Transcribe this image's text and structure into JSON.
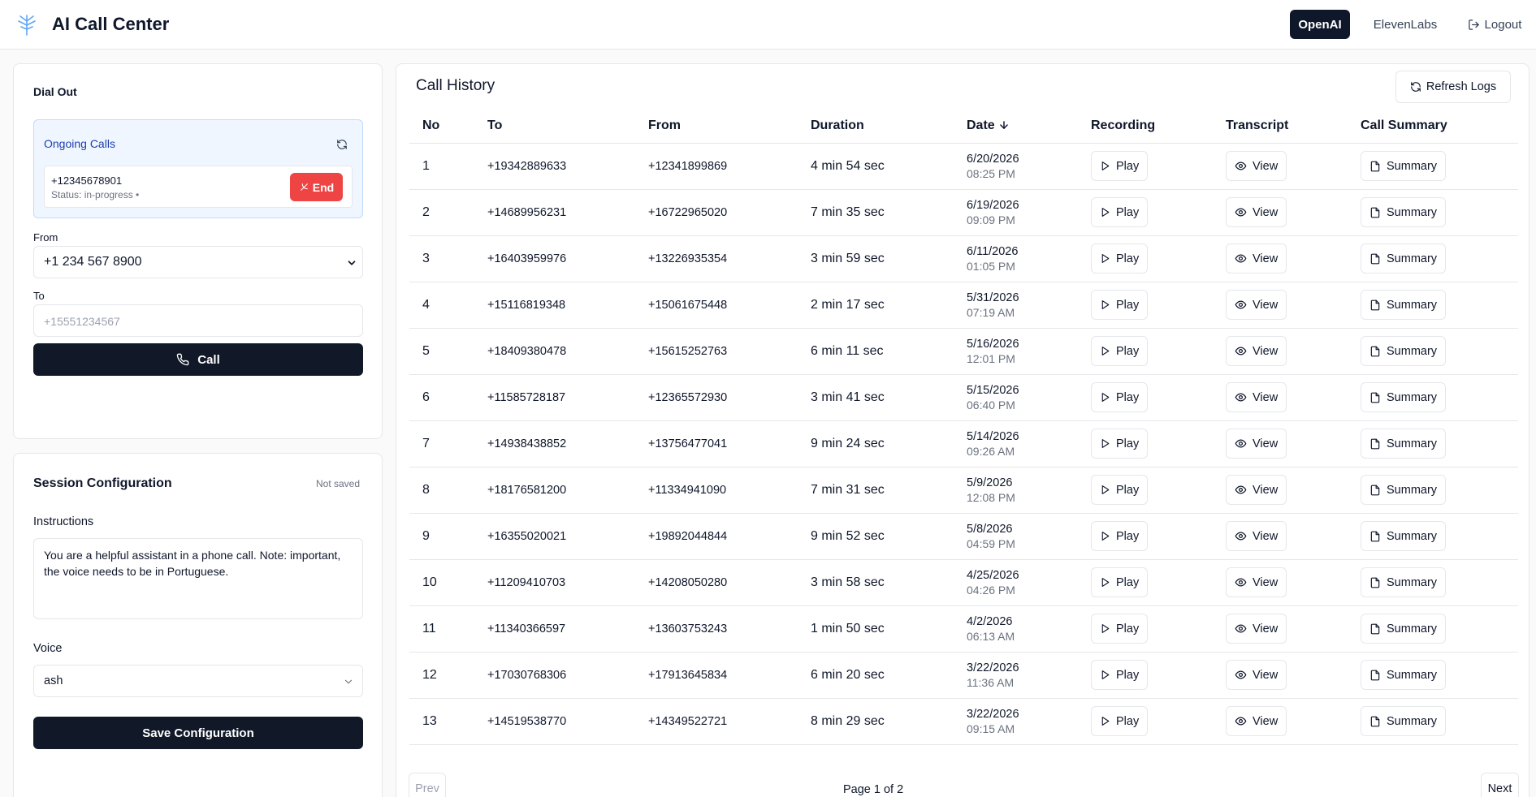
{
  "header": {
    "title": "AI Call Center",
    "providers": [
      "OpenAI",
      "ElevenLabs"
    ],
    "active_provider": "OpenAI",
    "logout_label": "Logout"
  },
  "dial_out": {
    "title": "Dial Out",
    "ongoing": {
      "title": "Ongoing Calls",
      "calls": [
        {
          "number": "+12345678901",
          "status": "Status: in-progress •",
          "end_label": "End"
        }
      ]
    },
    "from_label": "From",
    "from_value": "+1 234 567 8900",
    "to_label": "To",
    "to_placeholder": "+15551234567",
    "call_label": "Call"
  },
  "session": {
    "title": "Session Configuration",
    "status": "Not saved",
    "instructions_label": "Instructions",
    "instructions_value": "You are a helpful assistant in a phone call. Note: important, the voice needs to be in Portuguese.",
    "voice_label": "Voice",
    "voice_value": "ash",
    "save_label": "Save Configuration"
  },
  "history": {
    "title": "Call History",
    "refresh_label": "Refresh Logs",
    "columns": [
      "No",
      "To",
      "From",
      "Duration",
      "Date",
      "Recording",
      "Transcript",
      "Call Summary"
    ],
    "play_label": "Play",
    "view_label": "View",
    "summary_label": "Summary",
    "rows": [
      {
        "no": "1",
        "to": "+19342889633",
        "from": "+12341899869",
        "duration": "4 min 54 sec",
        "date": "6/20/2026",
        "time": "08:25 PM"
      },
      {
        "no": "2",
        "to": "+14689956231",
        "from": "+16722965020",
        "duration": "7 min 35 sec",
        "date": "6/19/2026",
        "time": "09:09 PM"
      },
      {
        "no": "3",
        "to": "+16403959976",
        "from": "+13226935354",
        "duration": "3 min 59 sec",
        "date": "6/11/2026",
        "time": "01:05 PM"
      },
      {
        "no": "4",
        "to": "+15116819348",
        "from": "+15061675448",
        "duration": "2 min 17 sec",
        "date": "5/31/2026",
        "time": "07:19 AM"
      },
      {
        "no": "5",
        "to": "+18409380478",
        "from": "+15615252763",
        "duration": "6 min 11 sec",
        "date": "5/16/2026",
        "time": "12:01 PM"
      },
      {
        "no": "6",
        "to": "+11585728187",
        "from": "+12365572930",
        "duration": "3 min 41 sec",
        "date": "5/15/2026",
        "time": "06:40 PM"
      },
      {
        "no": "7",
        "to": "+14938438852",
        "from": "+13756477041",
        "duration": "9 min 24 sec",
        "date": "5/14/2026",
        "time": "09:26 AM"
      },
      {
        "no": "8",
        "to": "+18176581200",
        "from": "+11334941090",
        "duration": "7 min 31 sec",
        "date": "5/9/2026",
        "time": "12:08 PM"
      },
      {
        "no": "9",
        "to": "+16355020021",
        "from": "+19892044844",
        "duration": "9 min 52 sec",
        "date": "5/8/2026",
        "time": "04:59 PM"
      },
      {
        "no": "10",
        "to": "+11209410703",
        "from": "+14208050280",
        "duration": "3 min 58 sec",
        "date": "4/25/2026",
        "time": "04:26 PM"
      },
      {
        "no": "11",
        "to": "+11340366597",
        "from": "+13603753243",
        "duration": "1 min 50 sec",
        "date": "4/2/2026",
        "time": "06:13 AM"
      },
      {
        "no": "12",
        "to": "+17030768306",
        "from": "+17913645834",
        "duration": "6 min 20 sec",
        "date": "3/22/2026",
        "time": "11:36 AM"
      },
      {
        "no": "13",
        "to": "+14519538770",
        "from": "+14349522721",
        "duration": "8 min 29 sec",
        "date": "3/22/2026",
        "time": "09:15 AM"
      }
    ],
    "pager": {
      "prev_label": "Prev",
      "next_label": "Next",
      "page_text": "Page 1 of 2"
    }
  },
  "colors": {
    "primary": "#111827",
    "danger": "#ef4444",
    "ongoing_bg": "#eff6ff",
    "ongoing_text": "#1e40af"
  }
}
